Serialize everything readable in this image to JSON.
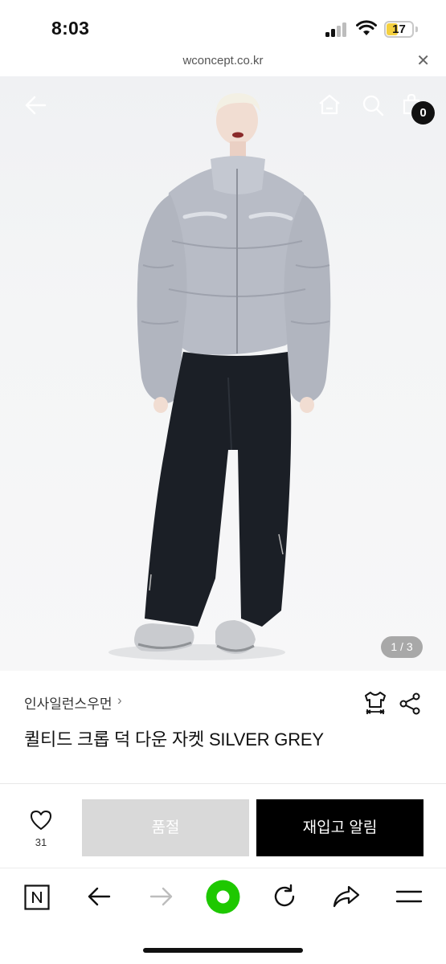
{
  "status_bar": {
    "time": "8:03",
    "battery": "17"
  },
  "browser": {
    "url": "wconcept.co.kr",
    "close_icon": "close-icon"
  },
  "hero": {
    "cart_count": "0",
    "page_indicator": "1 / 3",
    "icons": [
      "back-arrow-icon",
      "home-icon",
      "search-icon",
      "shopping-bag-icon"
    ]
  },
  "product": {
    "brand": "인사일런스우먼",
    "brand_chevron": "›",
    "title": "퀼티드 크롭 덕 다운 자켓 SILVER GREY"
  },
  "actions": {
    "like_count": "31",
    "soldout_label": "품절",
    "restock_label": "재입고 알림"
  },
  "toolbar": {
    "items": [
      "naver-n-icon",
      "back-icon",
      "forward-icon",
      "green-dot-icon",
      "refresh-icon",
      "share-arrow-icon",
      "menu-icon"
    ]
  },
  "colors": {
    "accent_green": "#1ec800",
    "soldout_bg": "#d9d9d9",
    "primary_button": "#000000",
    "jacket": "#b8bcc6",
    "pants": "#1b1f26"
  }
}
